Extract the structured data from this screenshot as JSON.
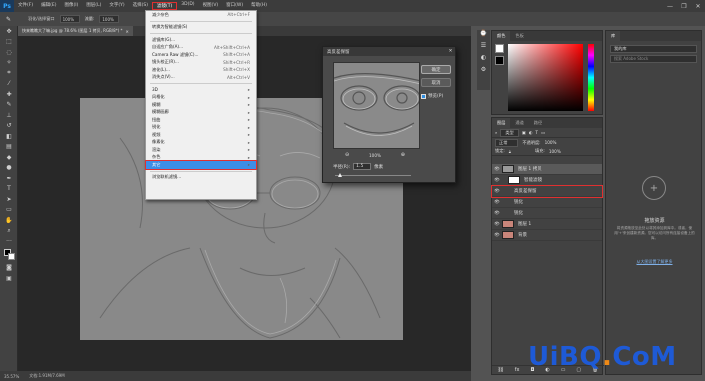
{
  "app": {
    "logo": "Ps"
  },
  "menubar": {
    "items": [
      "文件(F)",
      "编辑(E)",
      "图像(I)",
      "图层(L)",
      "文字(Y)",
      "选择(S)",
      "滤镜(T)",
      "3D(D)",
      "视图(V)",
      "窗口(W)",
      "帮助(H)"
    ],
    "active": "滤镜(T)",
    "window_buttons": [
      "—",
      "❐",
      "✕"
    ]
  },
  "options_bar": {
    "mode_label": "羽化/选择窗口",
    "opacity": "100%",
    "flow_label": "流量:",
    "flow": "100%"
  },
  "document": {
    "tab_title": "快来瞧瞧大了嘛.jpg @ 78.6% (图层 1 拷贝, RGB/8*) *",
    "close": "✕"
  },
  "status": {
    "zoom": "35.57%",
    "doc_info": "文档:1.91M/7.69M"
  },
  "filter_menu": {
    "items": [
      {
        "label": "减少杂色",
        "shortcut": "Alt+Ctrl+F",
        "disabled": false
      },
      {
        "sep": true
      },
      {
        "label": "转换为智能滤镜(S)",
        "shortcut": "",
        "disabled": false
      },
      {
        "sep": true
      },
      {
        "label": "滤镜库(G)...",
        "shortcut": "",
        "disabled": false
      },
      {
        "label": "自适应广角(A)...",
        "shortcut": "Alt+Shift+Ctrl+A",
        "disabled": false
      },
      {
        "label": "Camera Raw 滤镜(C)...",
        "shortcut": "Shift+Ctrl+A",
        "disabled": false
      },
      {
        "label": "镜头校正(R)...",
        "shortcut": "Shift+Ctrl+R",
        "disabled": false
      },
      {
        "label": "液化(L)...",
        "shortcut": "Shift+Ctrl+X",
        "disabled": false
      },
      {
        "label": "消失点(V)...",
        "shortcut": "Alt+Ctrl+V",
        "disabled": false
      },
      {
        "sep": true
      },
      {
        "label": "3D",
        "shortcut": "▸",
        "disabled": false
      },
      {
        "label": "风格化",
        "shortcut": "▸",
        "disabled": false
      },
      {
        "label": "模糊",
        "shortcut": "▸",
        "disabled": false
      },
      {
        "label": "模糊画廊",
        "shortcut": "▸",
        "disabled": false
      },
      {
        "label": "扭曲",
        "shortcut": "▸",
        "disabled": false
      },
      {
        "label": "锐化",
        "shortcut": "▸",
        "disabled": false
      },
      {
        "label": "视频",
        "shortcut": "▸",
        "disabled": false
      },
      {
        "label": "像素化",
        "shortcut": "▸",
        "disabled": false
      },
      {
        "label": "渲染",
        "shortcut": "▸",
        "disabled": false
      },
      {
        "label": "杂色",
        "shortcut": "▸",
        "disabled": false
      },
      {
        "label": "其它",
        "shortcut": "▸",
        "disabled": false,
        "highlight": true
      },
      {
        "sep": true
      },
      {
        "label": "浏览联机滤镜...",
        "shortcut": "",
        "disabled": false
      }
    ]
  },
  "dialog": {
    "title": "高反差保留",
    "ok": "确定",
    "cancel": "取消",
    "preview_label": "预览(P)",
    "zoom": "100%",
    "radius_label": "半径(R):",
    "radius_value": "1.5",
    "unit": "像素",
    "zoom_out": "⊖",
    "zoom_in": "⊕"
  },
  "color_panel": {
    "tabs": [
      "颜色",
      "色板"
    ]
  },
  "libraries_panel": {
    "tab": "库",
    "library_select": "我的库",
    "search_placeholder": "搜索 Adobe Stock",
    "empty_title": "拖放资源",
    "empty_text": "将资源拖放至此处以将其添加到库中。或者，使用'+'来创建新资源。您可以访问所有连接设备上的库。",
    "learn_more": "从大图设置了解更多"
  },
  "layers_panel": {
    "tabs": [
      "图层",
      "通道",
      "路径"
    ],
    "kind_label": "类型",
    "blend_mode": "正常",
    "opacity_label": "不透明度:",
    "opacity": "100%",
    "lock_label": "锁定:",
    "fill_label": "填充:",
    "fill": "100%",
    "layers": [
      {
        "name": "图层 1 拷贝",
        "type": "smart",
        "indent": 0,
        "selected": true
      },
      {
        "name": "智能滤镜",
        "type": "sub",
        "indent": 1,
        "selected": false
      },
      {
        "name": "高反差保留",
        "type": "filter",
        "indent": 2,
        "selected": false,
        "highlight": true
      },
      {
        "name": "锐化",
        "type": "filter",
        "indent": 2,
        "selected": false
      },
      {
        "name": "锐化",
        "type": "filter",
        "indent": 2,
        "selected": false
      },
      {
        "name": "图层 1",
        "type": "photo",
        "indent": 0,
        "selected": false
      },
      {
        "name": "背景",
        "type": "photo",
        "indent": 0,
        "selected": false
      }
    ]
  },
  "watermark": {
    "part1": "UiBQ",
    "dot": ".",
    "part2": "CoM"
  },
  "colors": {
    "accent_red": "#e03030",
    "menu_highlight": "#3d8ee6",
    "watermark_blue": "#1e5ad6",
    "watermark_orange": "#f08a16"
  }
}
